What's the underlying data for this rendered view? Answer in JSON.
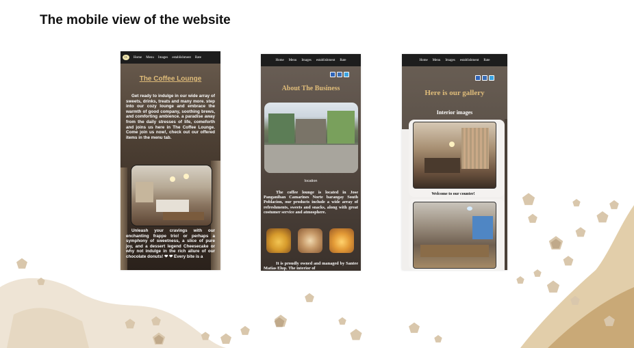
{
  "slide": {
    "title": "The mobile view of the website"
  },
  "nav": {
    "items": [
      "Home",
      "Menu",
      "Images",
      "establishment",
      "Rate"
    ],
    "logo_text": "CL"
  },
  "screen1": {
    "heading": "The Coffee Lounge",
    "intro": "Get ready to indulge in our wide array of sweets, drinks, treats and many more. step into our cozy lounge and embrace the warmth of good company, soothing brews, and comforting ambience. a paradise away from the daily stresses of life, comeforth and joins us here in The Coffee Lounge. Come join us now!, check out our offered items in the menu tab.",
    "cravings": "Unleash your cravings with our enchanting frappe trio! or perhaps a symphony of sweetness, a slice of pure joy, and a dessert legend Cheesecake or why not indulge in the rich allure of our chocolate donuts! ❤ ❤ Every bite is a"
  },
  "screen2": {
    "heading": "About The Business",
    "location_label": "location",
    "location_text": "The coffee lounge is located in Jose Panganiban Camarines Norte barangay South Poblacion, our products include a wide array of refreshments, sweets and snacks, along with great costumer service and atmosphere.",
    "owner_text": "It is proudly owned and managed by Santee Matias Elup. The interior of"
  },
  "screen3": {
    "heading": "Here is our gallery",
    "subheading": "Interior images",
    "caption1": "Welcome to our counter!"
  },
  "colors": {
    "gold": "#e0bd7a",
    "nav_bg": "#1d1d1d",
    "confetti": "#d9c3a1"
  }
}
